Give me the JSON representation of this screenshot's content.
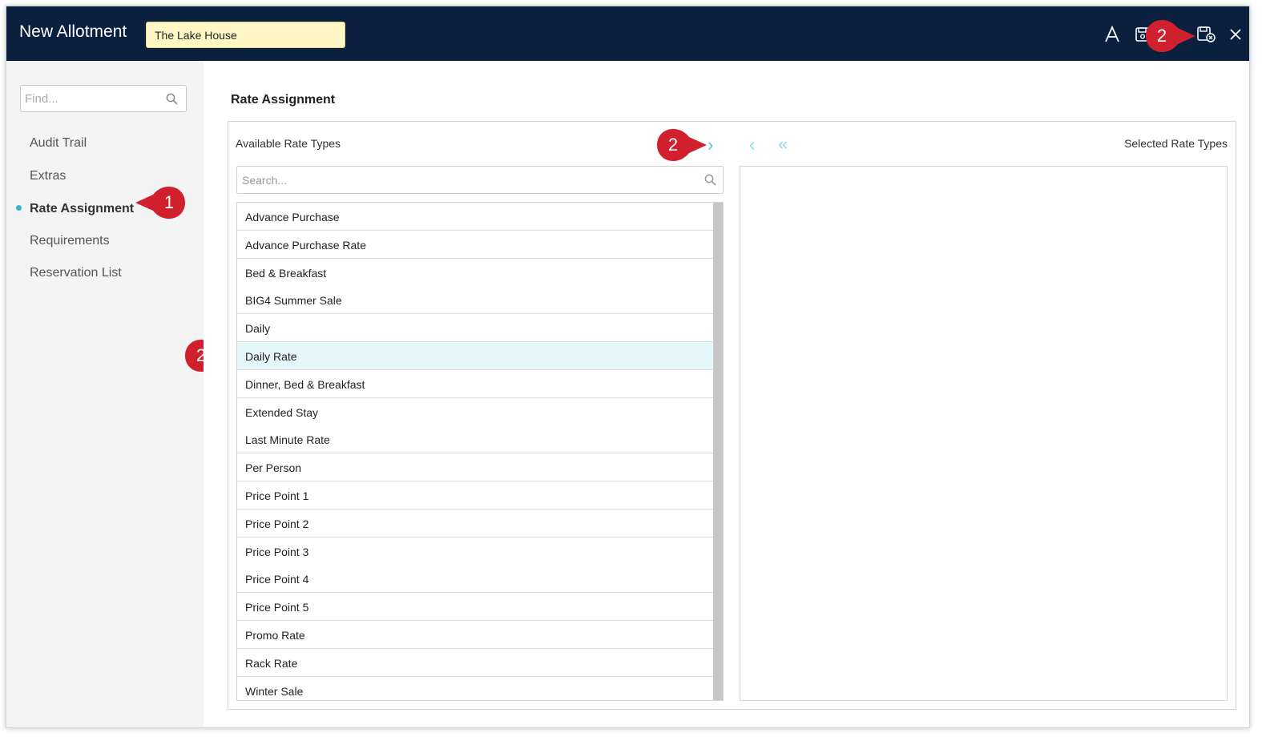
{
  "window": {
    "title": "New Allotment",
    "name_value": "The Lake House"
  },
  "toolbar": {
    "font_icon": "font-size-icon",
    "save_icon": "save-icon",
    "save_close_icon": "save-and-close-icon",
    "close_icon": "close-icon"
  },
  "sidebar": {
    "find_placeholder": "Find...",
    "items": [
      {
        "label": "Audit Trail"
      },
      {
        "label": "Extras"
      },
      {
        "label": "Rate Assignment",
        "active": true
      },
      {
        "label": "Requirements"
      },
      {
        "label": "Reservation List"
      }
    ]
  },
  "main": {
    "title": "Rate Assignment",
    "available_label": "Available Rate Types",
    "selected_label": "Selected Rate Types",
    "search_placeholder": "Search...",
    "rates": [
      "Advance Purchase",
      "Advance Purchase Rate",
      "Bed & Breakfast",
      "BIG4 Summer Sale",
      "Daily",
      "Daily Rate",
      "Dinner, Bed & Breakfast",
      "Extended Stay",
      "Last Minute Rate",
      "Per Person",
      "Price Point 1",
      "Price Point 2",
      "Price Point 3",
      "Price Point 4",
      "Price Point 5",
      "Promo Rate",
      "Rack Rate",
      "Winter Sale"
    ],
    "selected_rate": "Daily Rate",
    "move_right_symbol": "›",
    "move_left_symbol": "‹",
    "move_all_left_symbol": "«"
  },
  "callouts": [
    {
      "label": "1",
      "target": "sidebar-rate-assignment"
    },
    {
      "label": "2",
      "target": "daily-rate-row"
    },
    {
      "label": "2",
      "target": "move-right-button"
    },
    {
      "label": "2",
      "target": "save-and-close-button"
    }
  ],
  "colors": {
    "titlebar": "#0b1f3f",
    "accent": "#36b7c9",
    "callout": "#d0202e",
    "name_box": "#fff8c5",
    "selected_row": "#e6f7fb"
  }
}
